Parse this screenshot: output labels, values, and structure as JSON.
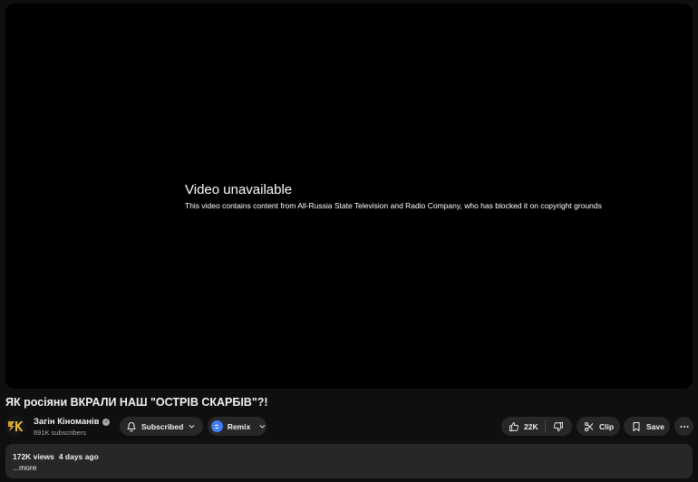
{
  "player": {
    "error_title": "Video unavailable",
    "error_message": "This video contains content from All-Russia State Television and Radio Company, who has blocked it on copyright grounds"
  },
  "video": {
    "title": "ЯК росіяни ВКРАЛИ НАШ \"ОСТРІВ СКАРБІВ\"?!",
    "views": "172K views",
    "age": "4 days ago",
    "more_label": "...more"
  },
  "channel": {
    "name": "Загін Кіноманів",
    "subscribers": "691K subscribers",
    "avatar_icon": "channel-logo-3k",
    "verified_icon": "check-circle-icon"
  },
  "actions": {
    "subscribe_label": "Subscribed",
    "remix_label": "Remix",
    "like_count": "22K",
    "clip_label": "Clip",
    "save_label": "Save"
  },
  "colors": {
    "background": "#0f0f0f",
    "player": "#000000",
    "pill": "#272727",
    "accent_remix": "#3d7df5",
    "secondary_text": "#aaaaaa"
  }
}
